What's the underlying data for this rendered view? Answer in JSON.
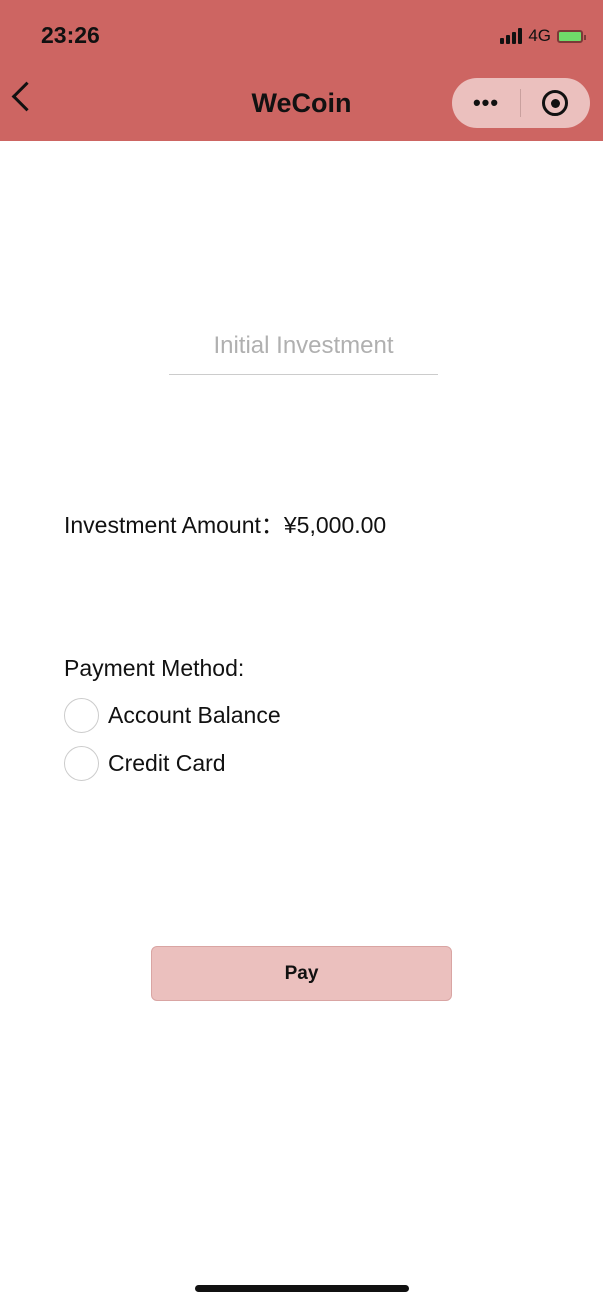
{
  "status_bar": {
    "time": "23:26",
    "network": "4G"
  },
  "nav": {
    "title": "WeCoin",
    "more": "•••"
  },
  "form": {
    "investment_placeholder": "Initial Investment",
    "amount_label": "Investment Amount：",
    "amount_value": "¥5,000.00",
    "payment_label": "Payment Method:",
    "options": [
      {
        "label": "Account Balance",
        "selected": false
      },
      {
        "label": "Credit Card",
        "selected": false
      }
    ],
    "pay_label": "Pay"
  },
  "colors": {
    "header": "#cd6562",
    "button": "#ebc0be"
  }
}
